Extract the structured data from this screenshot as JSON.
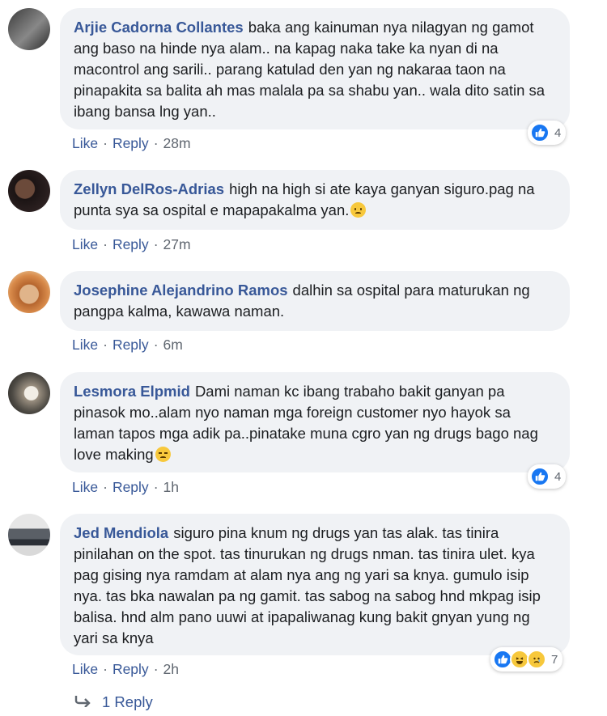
{
  "actions": {
    "like_label": "Like",
    "reply_label": "Reply",
    "separator": "·"
  },
  "comments": [
    {
      "author": "Arjie Cadorna Collantes",
      "text": "baka ang kainuman nya nilagyan ng gamot ang baso na hinde nya alam.. na kapag naka take ka nyan di na macontrol ang sarili.. parang katulad den yan ng nakaraa taon na pinapakita sa balita ah mas malala pa sa shabu yan.. wala dito satin sa ibang bansa lng yan..",
      "time": "28m",
      "reaction_count": "4"
    },
    {
      "author": "Zellyn DelRos-Adrias",
      "text": "high na high si ate kaya ganyan siguro.pag na punta sya sa ospital e mapapakalma yan.",
      "time": "27m"
    },
    {
      "author": "Josephine Alejandrino Ramos",
      "text": "dalhin sa ospital para maturukan ng pangpa kalma, kawawa naman.",
      "time": "6m"
    },
    {
      "author": "Lesmora Elpmid",
      "text": "Dami naman kc ibang trabaho bakit ganyan pa pinasok mo..alam nyo naman mga foreign customer nyo hayok sa laman tapos mga adik pa..pinatake muna cgro yan ng drugs bago nag love making",
      "time": "1h",
      "reaction_count": "4"
    },
    {
      "author": "Jed Mendiola",
      "text": "siguro pina knum ng drugs yan tas alak. tas tinira pinilahan on the spot. tas tinurukan ng drugs nman. tas tinira ulet. kya pag gising nya ramdam at alam nya ang ng yari sa knya. gumulo isip nya. tas bka nawalan pa ng gamit. tas sabog na sabog hnd mkpag isip balisa. hnd alm pano uuwi at ipapaliwanag kung bakit gnyan yung ng yari sa knya",
      "time": "2h",
      "reaction_count": "7"
    }
  ],
  "replies_label": "1 Reply",
  "colors": {
    "link": "#385898",
    "bubble": "#f0f2f5",
    "meta": "#606770",
    "like_blue": "#1877f2"
  }
}
